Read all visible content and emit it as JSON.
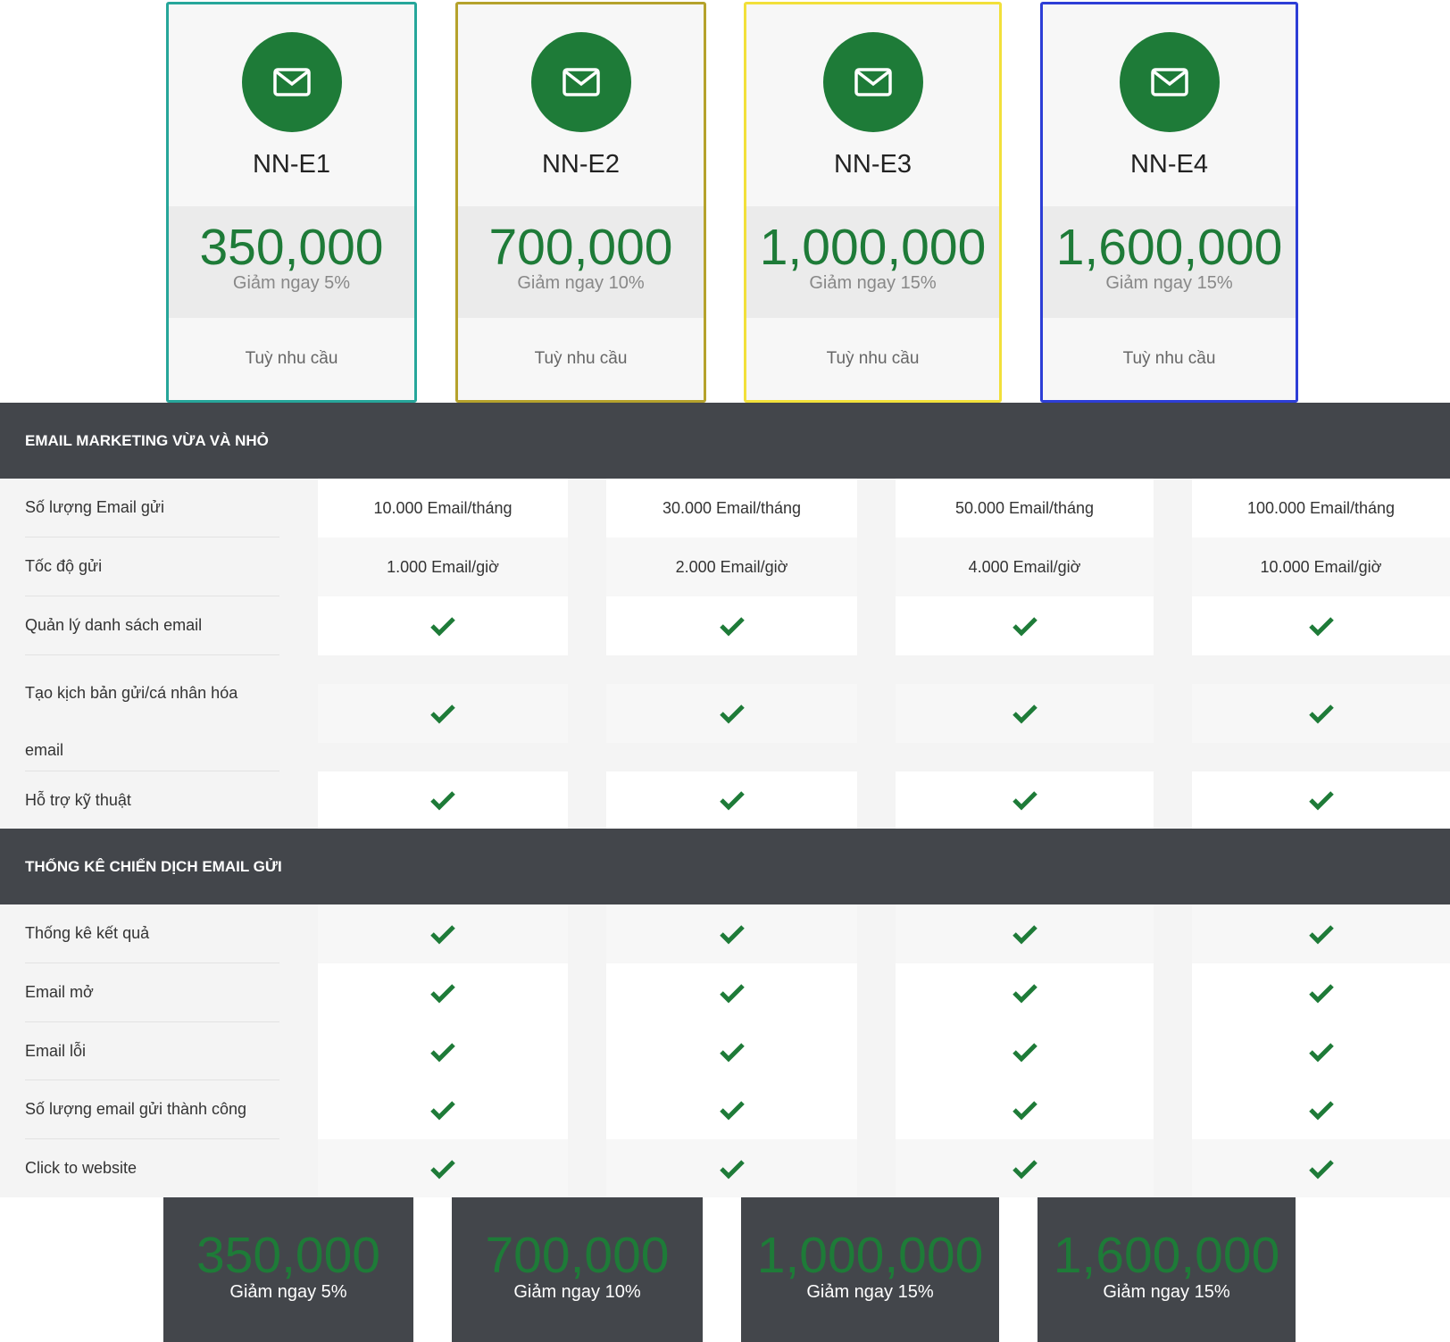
{
  "colors": {
    "accent_green": "#1e7b38",
    "header_dark": "#43464b",
    "card_border_1": "#26a69a",
    "card_border_2": "#b5a22c",
    "card_border_3": "#f2e03a",
    "card_border_4": "#2d3ed6"
  },
  "plans": [
    {
      "name": "NN-E1",
      "price": "350,000",
      "discount": "Giảm ngay 5%",
      "cta": "Tuỳ nhu cầu",
      "icon": "envelope-icon"
    },
    {
      "name": "NN-E2",
      "price": "700,000",
      "discount": "Giảm ngay 10%",
      "cta": "Tuỳ nhu cầu",
      "icon": "envelope-icon"
    },
    {
      "name": "NN-E3",
      "price": "1,000,000",
      "discount": "Giảm ngay 15%",
      "cta": "Tuỳ nhu cầu",
      "icon": "envelope-icon"
    },
    {
      "name": "NN-E4",
      "price": "1,600,000",
      "discount": "Giảm ngay 15%",
      "cta": "Tuỳ nhu cầu",
      "icon": "envelope-icon"
    }
  ],
  "sections": [
    {
      "title": "EMAIL MARKETING VỪA VÀ NHỎ",
      "rows": [
        {
          "label": "Số lượng Email gửi",
          "values": [
            "10.000 Email/tháng",
            "30.000 Email/tháng",
            "50.000 Email/tháng",
            "100.000 Email/tháng"
          ]
        },
        {
          "label": "Tốc độ gửi",
          "values": [
            "1.000 Email/giờ",
            "2.000 Email/giờ",
            "4.000 Email/giờ",
            "10.000 Email/giờ"
          ]
        },
        {
          "label": "Quản lý danh sách email",
          "values": [
            "check-icon",
            "check-icon",
            "check-icon",
            "check-icon"
          ]
        },
        {
          "label": "Tạo kịch bản gửi/cá nhân hóa email",
          "values": [
            "check-icon",
            "check-icon",
            "check-icon",
            "check-icon"
          ]
        },
        {
          "label": "Hỗ trợ kỹ thuật",
          "values": [
            "check-icon",
            "check-icon",
            "check-icon",
            "check-icon"
          ]
        }
      ]
    },
    {
      "title": "THỐNG KÊ CHIẾN DỊCH EMAIL GỬI",
      "rows": [
        {
          "label": "Thống kê kết quả",
          "values": [
            "check-icon",
            "check-icon",
            "check-icon",
            "check-icon"
          ]
        },
        {
          "label": "Email mở",
          "values": [
            "check-icon",
            "check-icon",
            "check-icon",
            "check-icon"
          ]
        },
        {
          "label": "Email lỗi",
          "values": [
            "check-icon",
            "check-icon",
            "check-icon",
            "check-icon"
          ]
        },
        {
          "label": "Số lượng email gửi thành công",
          "values": [
            "check-icon",
            "check-icon",
            "check-icon",
            "check-icon"
          ]
        },
        {
          "label": "Click to website",
          "values": [
            "check-icon",
            "check-icon",
            "check-icon",
            "check-icon"
          ]
        }
      ]
    }
  ],
  "bottom": [
    {
      "price": "350,000",
      "discount": "Giảm ngay 5%"
    },
    {
      "price": "700,000",
      "discount": "Giảm ngay 10%"
    },
    {
      "price": "1,000,000",
      "discount": "Giảm ngay 15%"
    },
    {
      "price": "1,600,000",
      "discount": "Giảm ngay 15%"
    }
  ]
}
